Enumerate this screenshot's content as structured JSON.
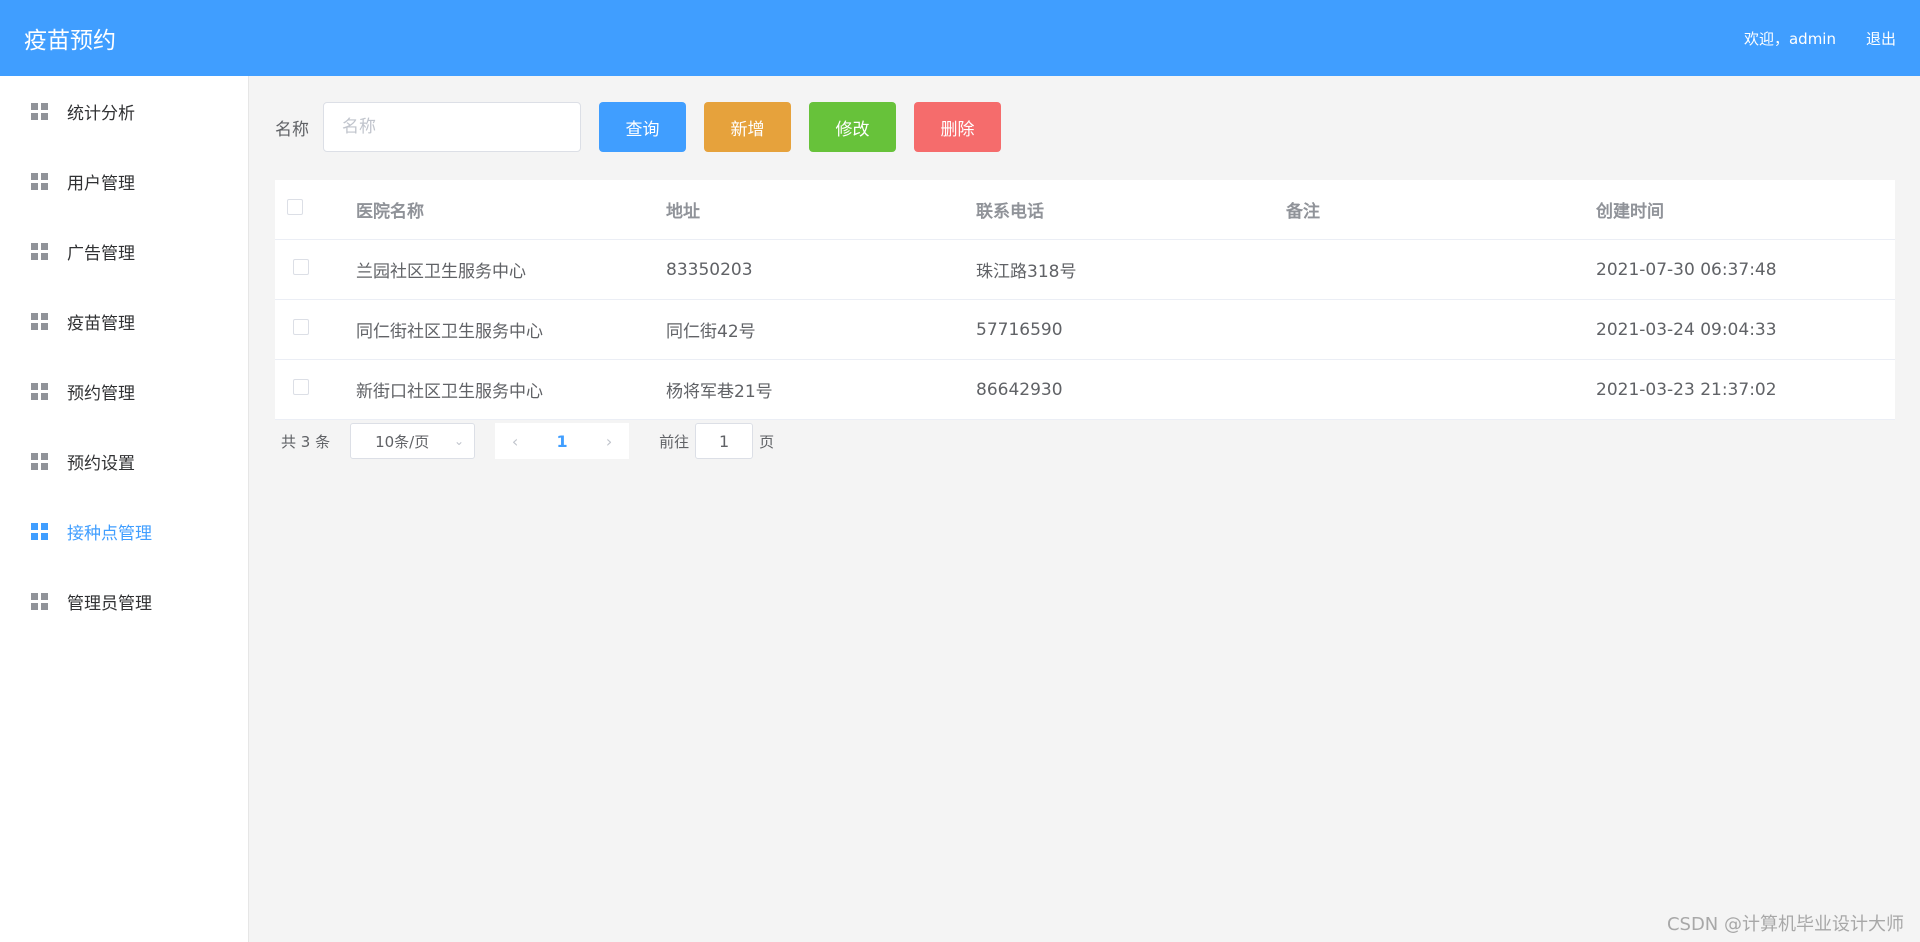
{
  "header": {
    "title": "疫苗预约",
    "welcome": "欢迎，admin",
    "logout": "退出"
  },
  "sidebar": {
    "items": [
      {
        "label": "统计分析",
        "active": false
      },
      {
        "label": "用户管理",
        "active": false
      },
      {
        "label": "广告管理",
        "active": false
      },
      {
        "label": "疫苗管理",
        "active": false
      },
      {
        "label": "预约管理",
        "active": false
      },
      {
        "label": "预约设置",
        "active": false
      },
      {
        "label": "接种点管理",
        "active": true
      },
      {
        "label": "管理员管理",
        "active": false
      }
    ],
    "accent_color": "#409eff"
  },
  "toolbar": {
    "name_label": "名称",
    "name_placeholder": "名称",
    "name_value": "",
    "query_label": "查询",
    "add_label": "新增",
    "edit_label": "修改",
    "delete_label": "删除"
  },
  "table": {
    "columns": [
      "医院名称",
      "地址",
      "联系电话",
      "备注",
      "创建时间"
    ],
    "rows": [
      [
        "兰园社区卫生服务中心",
        "83350203",
        "珠江路318号",
        "",
        "2021-07-30 06:37:48"
      ],
      [
        "同仁街社区卫生服务中心",
        "同仁街42号",
        "57716590",
        "",
        "2021-03-24 09:04:33"
      ],
      [
        "新街口社区卫生服务中心",
        "杨将军巷21号",
        "86642930",
        "",
        "2021-03-23 21:37:02"
      ]
    ]
  },
  "pagination": {
    "total_text": "共 3 条",
    "page_size": "10条/页",
    "current_page": "1",
    "goto_prefix": "前往",
    "goto_value": "1",
    "goto_suffix": "页"
  },
  "watermark": "CSDN @计算机毕业设计大师"
}
